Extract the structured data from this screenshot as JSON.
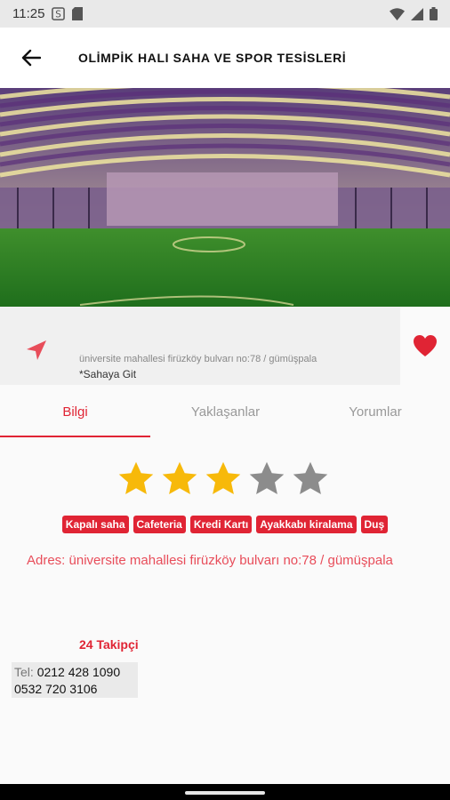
{
  "status_bar": {
    "time": "11:25",
    "left_icons": [
      "sync-icon",
      "sd-card-icon"
    ],
    "right_icons": [
      "wifi-icon",
      "signal-icon",
      "battery-icon"
    ]
  },
  "app_bar": {
    "back_icon": "arrow-left-icon",
    "title": "OLİMPİK HALI SAHA VE SPOR TESİSLERİ"
  },
  "hero": {
    "icon": "indoor-football-field-photo"
  },
  "info": {
    "followers": "24 Takipçi",
    "address": "üniversite mahallesi firüzköy bulvarı no:78 / gümüşpala",
    "goto": "*Sahaya Git",
    "location_icon": "navigation-arrow-icon",
    "favorite_icon": "heart-icon"
  },
  "tabs": [
    {
      "label": "Bilgi",
      "active": true
    },
    {
      "label": "Yaklaşanlar",
      "active": false
    },
    {
      "label": "Yorumlar",
      "active": false
    }
  ],
  "rating": {
    "value": 3,
    "max": 5
  },
  "features": [
    "Kapalı saha",
    "Cafeteria",
    "Kredi Kartı",
    "Ayakkabı kiralama",
    "Duş"
  ],
  "address_full": "Adres: üniversite mahallesi firüzköy bulvarı no:78 / gümüşpala",
  "phone": {
    "label": "Tel:",
    "numbers": [
      "0212 428 1090",
      "0532 720 3106"
    ]
  },
  "colors": {
    "accent": "#e02434",
    "star_on": "#f7b90a",
    "star_off": "#8c8c8c"
  }
}
